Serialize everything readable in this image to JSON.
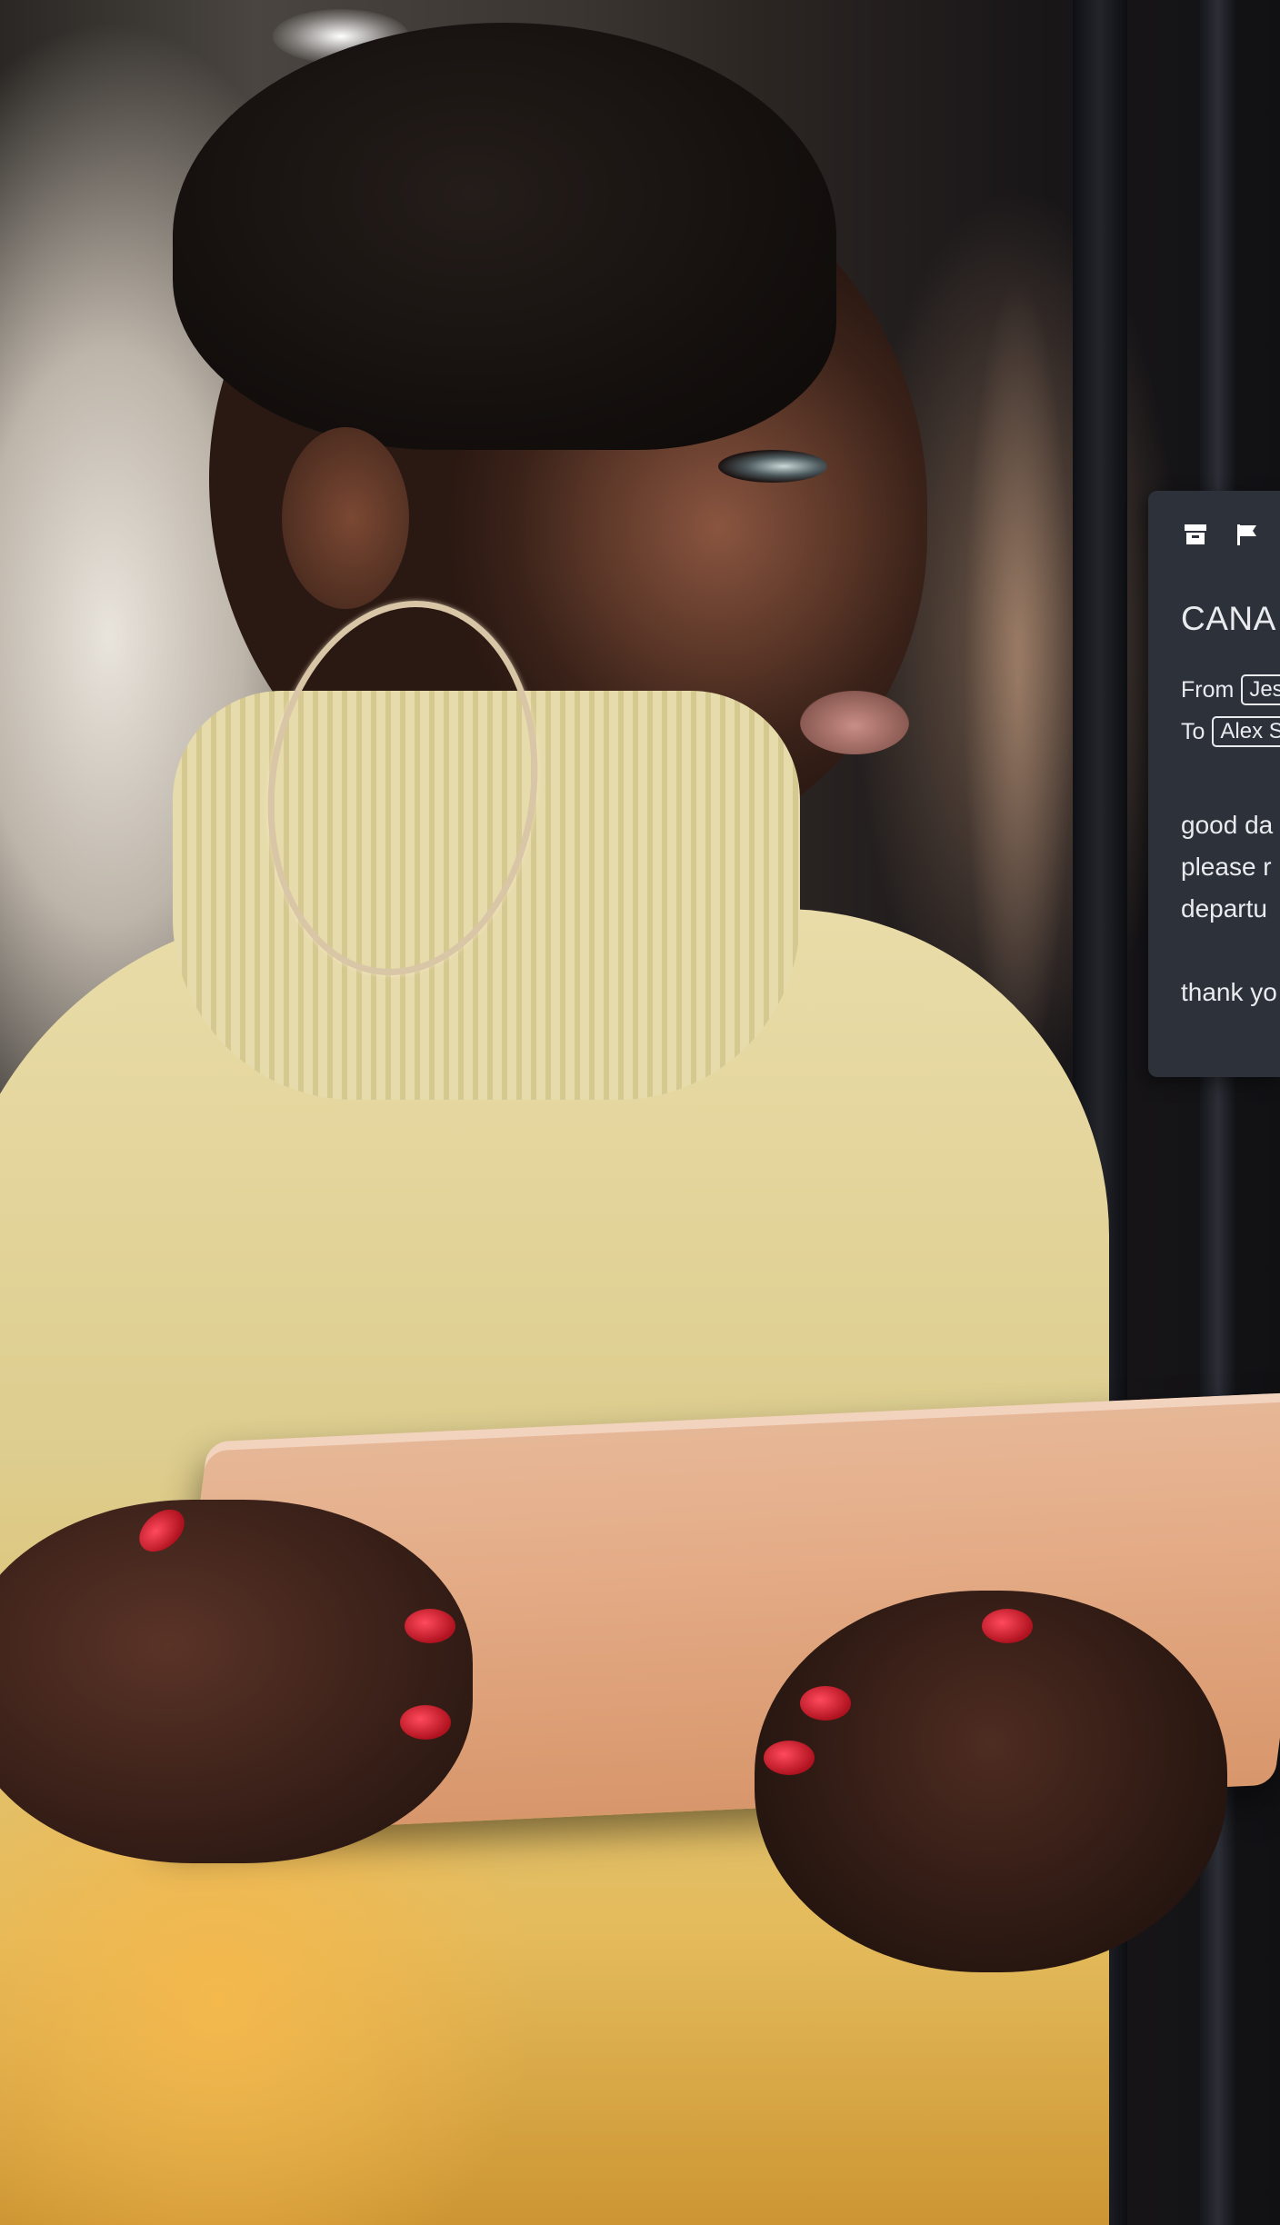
{
  "email_preview": {
    "toolbar": {
      "icons": [
        "archive-icon",
        "flag-icon"
      ]
    },
    "subject": "CANA",
    "from_label": "From",
    "from_value": "Jes",
    "to_label": "To",
    "to_value": "Alex S",
    "body_lines": [
      "good da",
      "please r",
      "departu",
      "",
      "thank yo"
    ]
  }
}
